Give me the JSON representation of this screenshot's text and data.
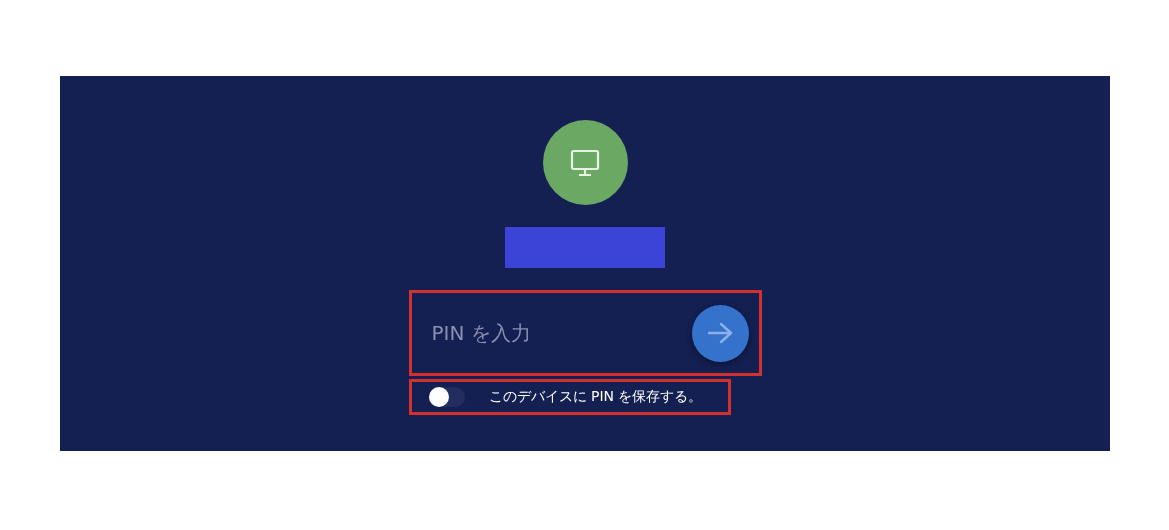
{
  "pin_field": {
    "placeholder": "PIN を入力"
  },
  "save_pin": {
    "label": "このデバイスに PIN を保存する。",
    "on": false
  }
}
